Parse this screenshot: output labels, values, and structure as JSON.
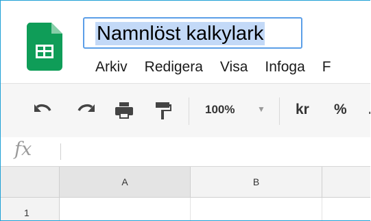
{
  "app": {
    "title": "Namnlöst kalkylark"
  },
  "menu": {
    "items": [
      "Arkiv",
      "Redigera",
      "Visa",
      "Infoga",
      "F"
    ]
  },
  "toolbar": {
    "icons": [
      "undo-icon",
      "redo-icon",
      "print-icon",
      "paint-format-icon"
    ],
    "zoom": "100%",
    "currency": "kr",
    "percent": "%"
  },
  "formula_bar": {
    "label": "fx",
    "value": ""
  },
  "grid": {
    "columns": [
      "A",
      "B"
    ],
    "rows": [
      "1"
    ]
  },
  "colors": {
    "frame": "#1ea0d6",
    "title_selection": "#c3d9f7",
    "title_border": "#5b9ee7",
    "sheets_green": "#0f9d58"
  }
}
